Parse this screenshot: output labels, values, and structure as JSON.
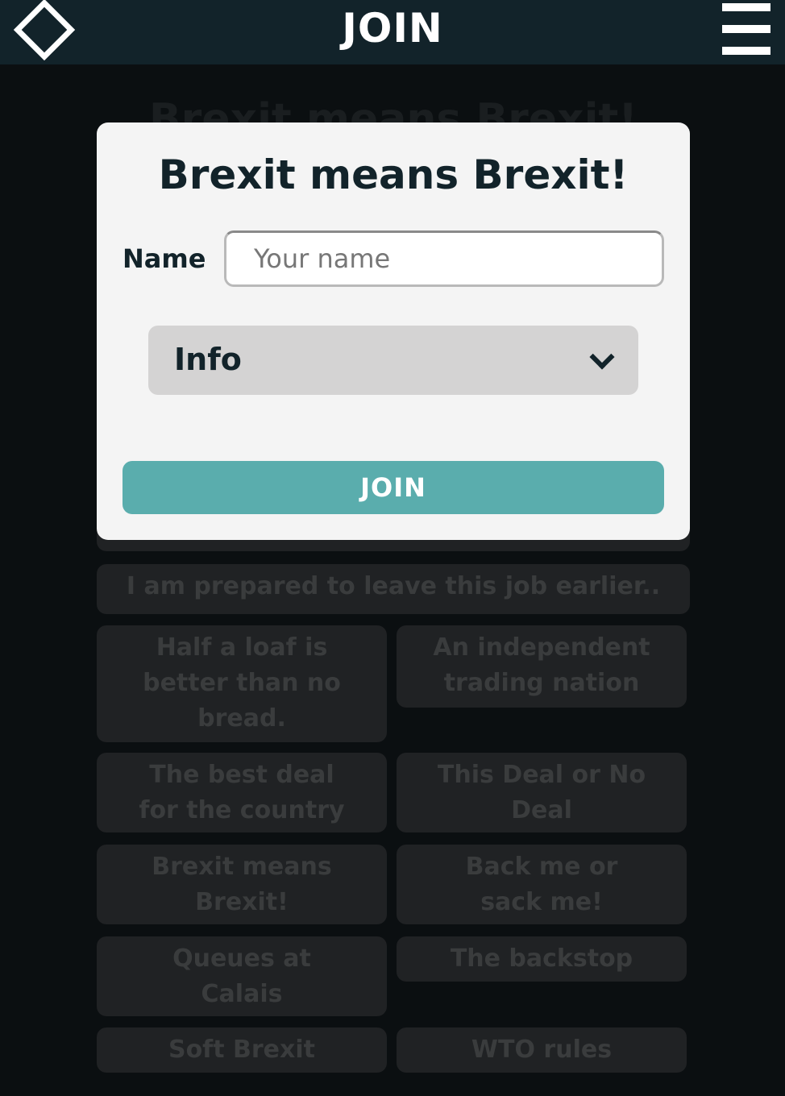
{
  "header": {
    "title": "JOIN",
    "logo_icon": "diamond-icon",
    "menu_icon": "hamburger-menu-icon"
  },
  "background": {
    "title": "Brexit means Brexit!",
    "tiles": [
      "I am prepared to leave this job earlier..",
      "Half a loaf is better than no bread.",
      "An independent trading nation",
      "The best deal for the country",
      "This Deal or No Deal",
      "Brexit means Brexit!",
      "Back me or sack me!",
      "Queues at Calais",
      "The backstop",
      "Soft Brexit",
      "WTO rules"
    ]
  },
  "modal": {
    "title": "Brexit means Brexit!",
    "name_label": "Name",
    "name_placeholder": "Your name",
    "select_value": "Info",
    "join_label": "JOIN"
  },
  "colors": {
    "header_bg": "#12232a",
    "page_bg": "#0b0f11",
    "modal_bg": "#f4f4f4",
    "accent": "#5aadad",
    "select_bg": "#d4d3d3"
  }
}
